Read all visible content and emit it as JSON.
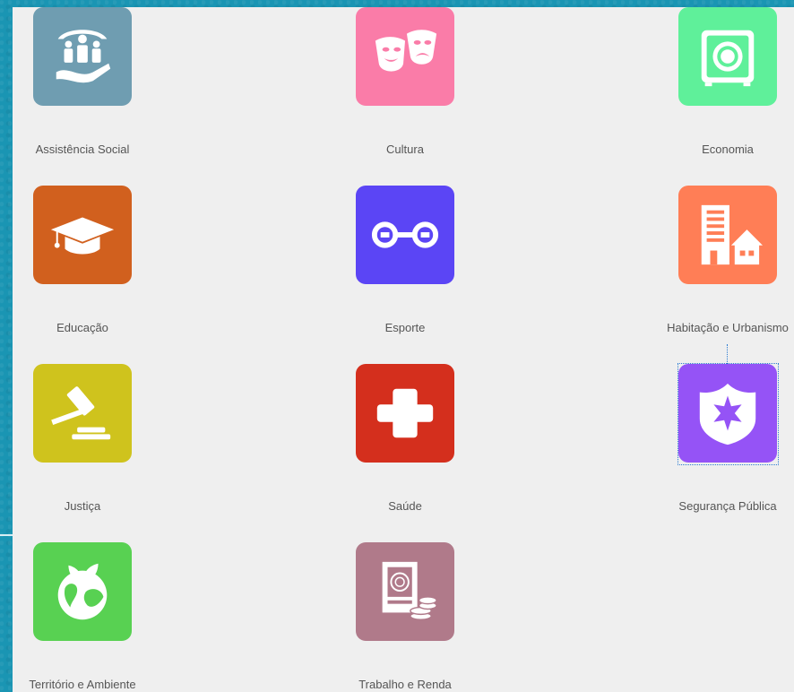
{
  "categories": [
    {
      "key": "assistencia",
      "label": "Assistência Social",
      "color": "#6f9db1",
      "icon": "family-hands-icon"
    },
    {
      "key": "cultura",
      "label": "Cultura",
      "color": "#fa7ca8",
      "icon": "theater-masks-icon"
    },
    {
      "key": "economia",
      "label": "Economia",
      "color": "#5ff09a",
      "icon": "safe-icon"
    },
    {
      "key": "educacao",
      "label": "Educação",
      "color": "#d1601e",
      "icon": "graduation-cap-icon"
    },
    {
      "key": "esporte",
      "label": "Esporte",
      "color": "#5b45f5",
      "icon": "dumbbell-icon"
    },
    {
      "key": "habitacao",
      "label": "Habitação e Urbanismo",
      "color": "#ff7e56",
      "icon": "buildings-icon"
    },
    {
      "key": "justica",
      "label": "Justiça",
      "color": "#cfc31d",
      "icon": "gavel-icon"
    },
    {
      "key": "saude",
      "label": "Saúde",
      "color": "#d42f1d",
      "icon": "medical-cross-icon"
    },
    {
      "key": "seguranca",
      "label": "Segurança Pública",
      "color": "#9553f6",
      "icon": "police-badge-icon",
      "focused": true
    },
    {
      "key": "territorio",
      "label": "Território e Ambiente",
      "color": "#58d152",
      "icon": "globe-plant-icon"
    },
    {
      "key": "trabalho",
      "label": "Trabalho e Renda",
      "color": "#b07a8a",
      "icon": "work-document-icon"
    }
  ]
}
